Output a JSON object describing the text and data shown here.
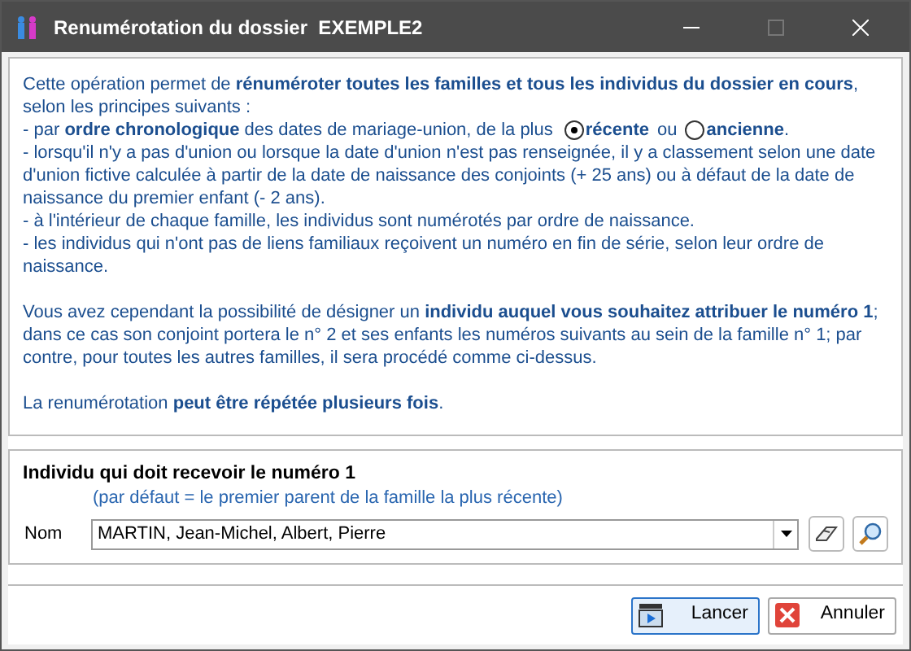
{
  "window": {
    "title": "Renumérotation du dossier  EXEMPLE2",
    "maximize_disabled": true
  },
  "description": {
    "sections": [
      [
        {
          "kind": "text",
          "text": "Cette opération permet de **rénuméroter toutes les familles et tous les individus du dossier en cours**, selon les principes suivants :"
        },
        {
          "kind": "radios",
          "text": "- par **ordre chronologique** des dates de mariage-union, de la plus",
          "connector": "ou",
          "suffix": ".",
          "options": [
            {
              "label": "récente",
              "selected": true
            },
            {
              "label": "ancienne",
              "selected": false
            }
          ]
        },
        {
          "kind": "text",
          "text": "- lorsqu'il n'y a pas d'union ou lorsque la date d'union n'est pas renseignée, il y a classement selon une date d'union fictive calculée à partir de la date de naissance des conjoints (+ 25 ans) ou à défaut de la date de naissance du premier enfant (- 2 ans)."
        },
        {
          "kind": "text",
          "text": "- à l'intérieur de chaque famille, les individus sont numérotés par ordre de naissance."
        },
        {
          "kind": "text",
          "text": "- les individus qui n'ont pas de liens familiaux reçoivent un numéro en fin de série, selon leur ordre de naissance."
        }
      ],
      [
        {
          "kind": "text",
          "text": "Vous avez cependant la possibilité de désigner un **individu auquel vous souhaitez attribuer le numéro 1**; dans ce cas son conjoint portera le n° 2 et ses enfants les numéros suivants au sein de la famille n° 1; par contre, pour toutes les autres familles, il sera procédé comme ci-dessus."
        }
      ],
      [
        {
          "kind": "text",
          "text": "La renumérotation **peut être répétée plusieurs fois**."
        }
      ]
    ]
  },
  "group": {
    "title": "Individu qui doit recevoir le numéro 1",
    "hint": "(par défaut = le premier parent de la famille la plus récente)",
    "field_label": "Nom",
    "value": "MARTIN, Jean-Michel, Albert, Pierre"
  },
  "buttons": [
    {
      "kind": "run",
      "label": "Lancer",
      "focused": true
    },
    {
      "kind": "cancel",
      "label": "Annuler",
      "focused": false
    }
  ]
}
